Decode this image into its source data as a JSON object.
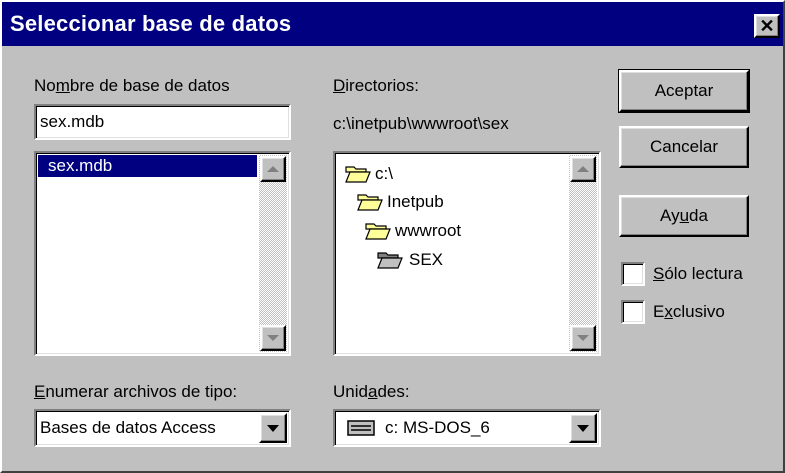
{
  "window": {
    "title": "Seleccionar base de datos",
    "close_glyph": "✕"
  },
  "db_name": {
    "label_pre": "No",
    "label_u": "m",
    "label_post": "bre de base de datos",
    "value": "sex.mdb",
    "files": [
      "sex.mdb"
    ]
  },
  "dirs": {
    "label_u": "D",
    "label_post": "irectorios:",
    "current_path": "c:\\inetpub\\wwwroot\\sex",
    "tree": [
      "c:\\",
      "Inetpub",
      "wwwroot",
      "SEX"
    ]
  },
  "filetype": {
    "label_u": "E",
    "label_post": "numerar archivos de tipo:",
    "selected": "Bases de datos Access"
  },
  "drives": {
    "label_pre": "Unid",
    "label_u": "a",
    "label_post": "des:",
    "selected": "c: MS-DOS_6"
  },
  "buttons": {
    "accept": "Aceptar",
    "cancel": "Cancelar",
    "help_pre": "Ay",
    "help_u": "u",
    "help_post": "da"
  },
  "options": {
    "readonly_u": "S",
    "readonly_post": "ólo lectura",
    "readonly_checked": false,
    "exclusive_pre": "E",
    "exclusive_u": "x",
    "exclusive_post": "clusivo",
    "exclusive_checked": false
  },
  "colors": {
    "titlebar": "#000080",
    "face": "#c0c0c0",
    "selection": "#000080",
    "folder": "#ffff99"
  },
  "icons": {
    "folder_closed": "folder-icon",
    "folder_open": "open-folder-icon",
    "drive": "drive-icon"
  }
}
